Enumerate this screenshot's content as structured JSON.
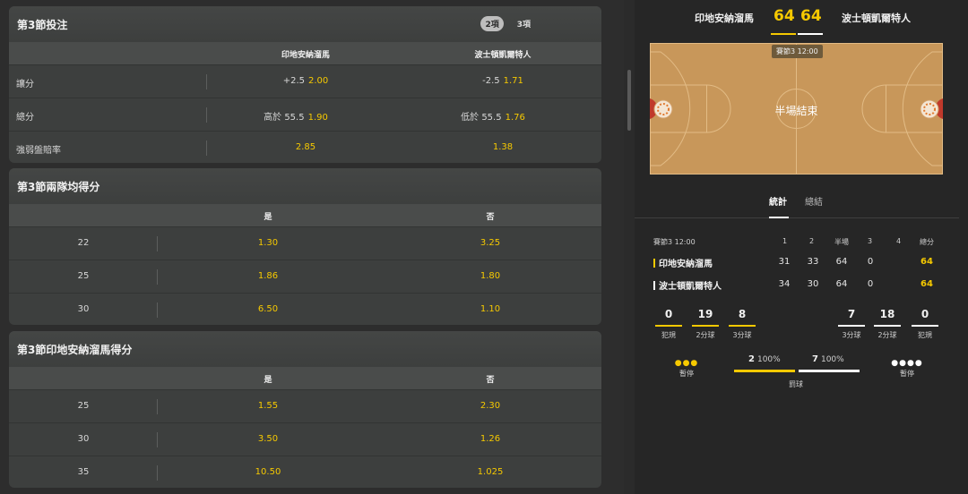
{
  "colors": {
    "accent": "#f6c900",
    "home": "#f6c900",
    "away": "#ffffff"
  },
  "markets": [
    {
      "title": "第3節投注",
      "pills": [
        "2項",
        "3項"
      ],
      "columns": [
        "印地安納溜馬",
        "波士頓凱爾特人"
      ],
      "rows": [
        {
          "label": "讓分",
          "home_line": "+2.5",
          "home_odd": "2.00",
          "away_line": "-2.5",
          "away_odd": "1.71"
        },
        {
          "label": "總分",
          "home_line": "高於 55.5",
          "home_odd": "1.90",
          "away_line": "低於 55.5",
          "away_odd": "1.76"
        },
        {
          "label": "強弱盤賠率",
          "home_line": "",
          "home_odd": "2.85",
          "away_line": "",
          "away_odd": "1.38"
        }
      ]
    },
    {
      "title": "第3節兩隊均得分",
      "columns": [
        "是",
        "否"
      ],
      "rows": [
        {
          "line": "22",
          "yes": "1.30",
          "no": "3.25"
        },
        {
          "line": "25",
          "yes": "1.86",
          "no": "1.80"
        },
        {
          "line": "30",
          "yes": "6.50",
          "no": "1.10"
        }
      ]
    },
    {
      "title": "第3節印地安納溜馬得分",
      "columns": [
        "是",
        "否"
      ],
      "rows": [
        {
          "line": "25",
          "yes": "1.55",
          "no": "2.30"
        },
        {
          "line": "30",
          "yes": "3.50",
          "no": "1.26"
        },
        {
          "line": "35",
          "yes": "10.50",
          "no": "1.025"
        }
      ]
    }
  ],
  "match": {
    "home_team": "印地安納溜馬",
    "away_team": "波士頓凱爾特人",
    "home_score": "64",
    "away_score": "64",
    "period_badge": "賽節3  12:00",
    "court_status": "半場結束",
    "tabs": [
      "統計",
      "總結"
    ],
    "stats": {
      "period_label": "賽節3  12:00",
      "headers": [
        "1",
        "2",
        "半場",
        "3",
        "4",
        "總分"
      ],
      "home_row": [
        "31",
        "33",
        "64",
        "0",
        "",
        "64"
      ],
      "away_row": [
        "34",
        "30",
        "64",
        "0",
        "",
        "64"
      ]
    },
    "home_kpis": [
      {
        "value": "0",
        "label": "犯規"
      },
      {
        "value": "19",
        "label": "2分球"
      },
      {
        "value": "8",
        "label": "3分球"
      }
    ],
    "away_kpis": [
      {
        "value": "7",
        "label": "3分球"
      },
      {
        "value": "18",
        "label": "2分球"
      },
      {
        "value": "0",
        "label": "犯規"
      }
    ],
    "timeouts": {
      "home": {
        "remaining": 3,
        "label": "暫停"
      },
      "away": {
        "remaining": 4,
        "label": "暫停"
      }
    },
    "free_throws": {
      "home_made": "2",
      "home_pct": "100%",
      "home_fraction": 1.0,
      "away_made": "7",
      "away_pct": "100%",
      "away_fraction": 1.0,
      "label": "罰球"
    }
  }
}
